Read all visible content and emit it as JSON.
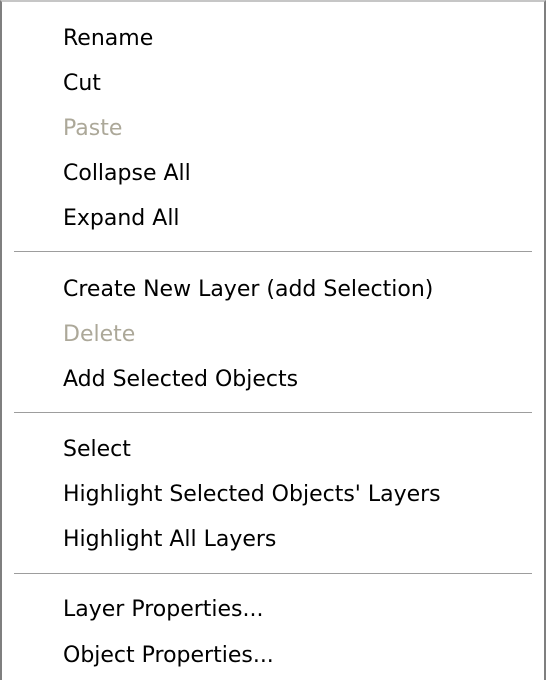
{
  "menu": {
    "items": [
      {
        "label": "Rename",
        "enabled": true
      },
      {
        "label": "Cut",
        "enabled": true
      },
      {
        "label": "Paste",
        "enabled": false
      },
      {
        "label": "Collapse All",
        "enabled": true
      },
      {
        "label": "Expand All",
        "enabled": true
      },
      {
        "label": "Create New Layer (add Selection)",
        "enabled": true
      },
      {
        "label": "Delete",
        "enabled": false
      },
      {
        "label": "Add Selected Objects",
        "enabled": true
      },
      {
        "label": "Select",
        "enabled": true
      },
      {
        "label": "Highlight Selected Objects' Layers",
        "enabled": true
      },
      {
        "label": "Highlight All Layers",
        "enabled": true
      },
      {
        "label": "Layer Properties...",
        "enabled": true
      },
      {
        "label": "Object Properties...",
        "enabled": true
      }
    ]
  },
  "colors": {
    "text": "#000000",
    "disabled_text": "#aca899",
    "separator": "#9d9d9d",
    "background": "#ffffff"
  }
}
